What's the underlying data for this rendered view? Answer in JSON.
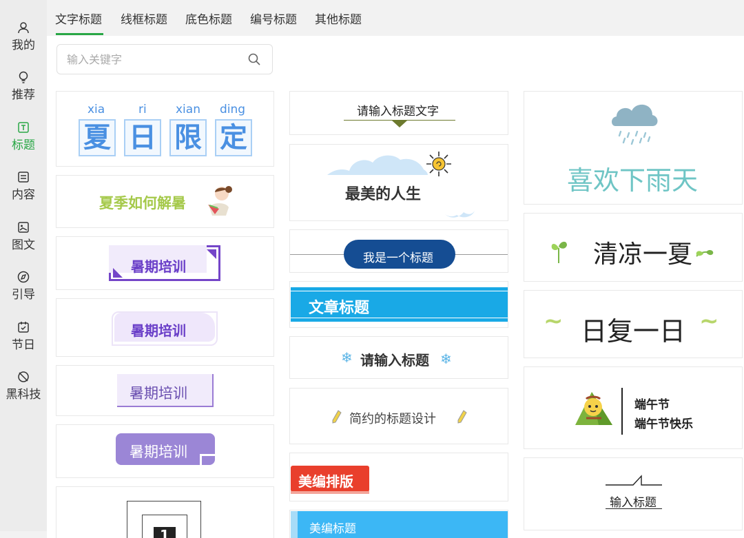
{
  "sidebar": {
    "items": [
      {
        "label": "我的",
        "icon": "user-icon"
      },
      {
        "label": "推荐",
        "icon": "lightbulb-icon"
      },
      {
        "label": "标题",
        "icon": "title-icon",
        "active": true
      },
      {
        "label": "内容",
        "icon": "document-icon"
      },
      {
        "label": "图文",
        "icon": "image-text-icon"
      },
      {
        "label": "引导",
        "icon": "compass-icon"
      },
      {
        "label": "节日",
        "icon": "calendar-icon"
      },
      {
        "label": "黑科技",
        "icon": "tech-icon"
      }
    ]
  },
  "tabs": [
    "文字标题",
    "线框标题",
    "底色标题",
    "编号标题",
    "其他标题"
  ],
  "search": {
    "placeholder": "输入关键字"
  },
  "cards": {
    "c1": {
      "pinyin": [
        "xia",
        "ri",
        "xian",
        "ding"
      ],
      "chars": [
        "夏",
        "日",
        "限",
        "定"
      ]
    },
    "c2": {
      "text": "夏季如何解暑"
    },
    "c3": {
      "text": "暑期培训"
    },
    "c4": {
      "text": "暑期培训"
    },
    "c5": {
      "text": "暑期培训"
    },
    "c6": {
      "text": "暑期培训"
    },
    "c7": {
      "number": "1"
    },
    "m1": {
      "text": "请输入标题文字"
    },
    "m2": {
      "text": "最美的人生"
    },
    "m3": {
      "text": "我是一个标题"
    },
    "m4": {
      "text": "文章标题"
    },
    "m5": {
      "text": "请输入标题"
    },
    "m6": {
      "text": "简约的标题设计"
    },
    "m7": {
      "text": "美编排版"
    },
    "m8": {
      "text": "美编标题"
    },
    "r1": {
      "text": "喜欢下雨天"
    },
    "r2": {
      "text": "清凉一夏"
    },
    "r3": {
      "text": "日复一日"
    },
    "r4": {
      "line1": "端午节",
      "line2": "端午节快乐"
    },
    "r5": {
      "text": "输入标题"
    }
  },
  "colors": {
    "accent": "#28a745",
    "blue": "#4a90e2",
    "purple": "#6a3fc8",
    "cyan": "#19a9e6"
  }
}
